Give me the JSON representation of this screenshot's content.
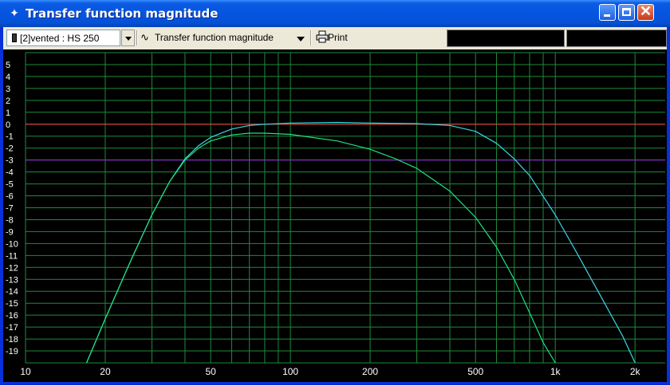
{
  "window": {
    "title": "Transfer function magnitude",
    "app_icon": "crosshair-icon",
    "controls": [
      "minimize-icon",
      "maximize-icon",
      "close-icon"
    ]
  },
  "toolbar": {
    "project_select": "[2]vented : HS 250",
    "graph_type": "Transfer function magnitude",
    "print_label": "Print"
  },
  "colors": {
    "plot_bg": "#000000",
    "grid": "#1F8A3C",
    "zero_line": "#FF3B3B",
    "minus3_line": "#A020F0",
    "curve_cyan": "#39D7E6",
    "curve_green": "#1FE27C",
    "axis_text": "#FFFFFF"
  },
  "chart_data": {
    "type": "line",
    "xscale": "log",
    "xlim": [
      10,
      2600
    ],
    "ylim": [
      -20,
      6
    ],
    "x_tick_labels": [
      "10",
      "20",
      "50",
      "100",
      "200",
      "500",
      "1k",
      "2k"
    ],
    "x_tick_values": [
      10,
      20,
      50,
      100,
      200,
      500,
      1000,
      2000
    ],
    "y_tick_labels": [
      "5",
      "4",
      "3",
      "2",
      "1",
      "0",
      "-1",
      "-2",
      "-3",
      "-4",
      "-5",
      "-6",
      "-7",
      "-8",
      "-9",
      "-10",
      "-11",
      "-12",
      "-13",
      "-14",
      "-15",
      "-16",
      "-17",
      "-18",
      "-19"
    ],
    "y_tick_values": [
      5,
      4,
      3,
      2,
      1,
      0,
      -1,
      -2,
      -3,
      -4,
      -5,
      -6,
      -7,
      -8,
      -9,
      -10,
      -11,
      -12,
      -13,
      -14,
      -15,
      -16,
      -17,
      -18,
      -19
    ],
    "reference_lines": [
      {
        "y": 0
      },
      {
        "y": -3
      }
    ],
    "series": [
      {
        "color": "#39D7E6",
        "x": [
          17,
          20,
          25,
          30,
          35,
          40,
          45,
          50,
          60,
          70,
          80,
          100,
          150,
          200,
          300,
          400,
          500,
          600,
          700,
          800,
          1000,
          1200,
          1500,
          1800,
          2000
        ],
        "y": [
          -20,
          -16.3,
          -11.4,
          -7.6,
          -4.8,
          -2.9,
          -1.8,
          -1.1,
          -0.4,
          -0.1,
          0.0,
          0.1,
          0.15,
          0.1,
          0.05,
          -0.1,
          -0.6,
          -1.6,
          -2.9,
          -4.3,
          -7.6,
          -10.7,
          -14.6,
          -17.8,
          -20
        ]
      },
      {
        "color": "#1FE27C",
        "x": [
          17,
          20,
          25,
          30,
          35,
          40,
          45,
          50,
          60,
          70,
          80,
          100,
          150,
          200,
          250,
          300,
          400,
          500,
          600,
          700,
          800,
          900,
          1000
        ],
        "y": [
          -20,
          -16.3,
          -11.4,
          -7.6,
          -4.8,
          -3.0,
          -2.0,
          -1.4,
          -0.9,
          -0.75,
          -0.75,
          -0.85,
          -1.4,
          -2.1,
          -2.9,
          -3.7,
          -5.6,
          -7.8,
          -10.3,
          -13.0,
          -15.8,
          -18.3,
          -20
        ]
      }
    ]
  }
}
